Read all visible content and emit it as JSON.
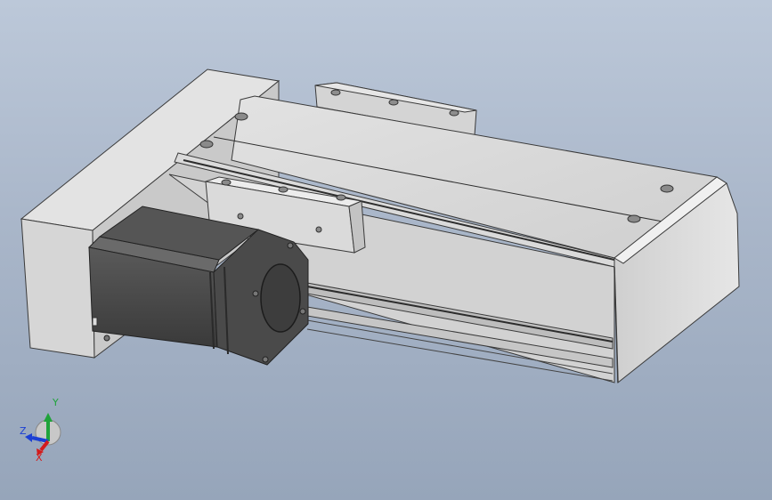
{
  "viewport": {
    "background_top": "#bcc8d9",
    "background_bottom": "#96a5ba"
  },
  "model": {
    "parts": [
      "motor-mount-block",
      "linear-module-body",
      "carriage-plate",
      "rear-bracket",
      "end-cap",
      "stepper-motor"
    ]
  },
  "triad": {
    "x_label": "X",
    "y_label": "Y",
    "z_label": "Z",
    "x_color": "#d41b1b",
    "y_color": "#1fa33a",
    "z_color": "#1b3fd4"
  }
}
